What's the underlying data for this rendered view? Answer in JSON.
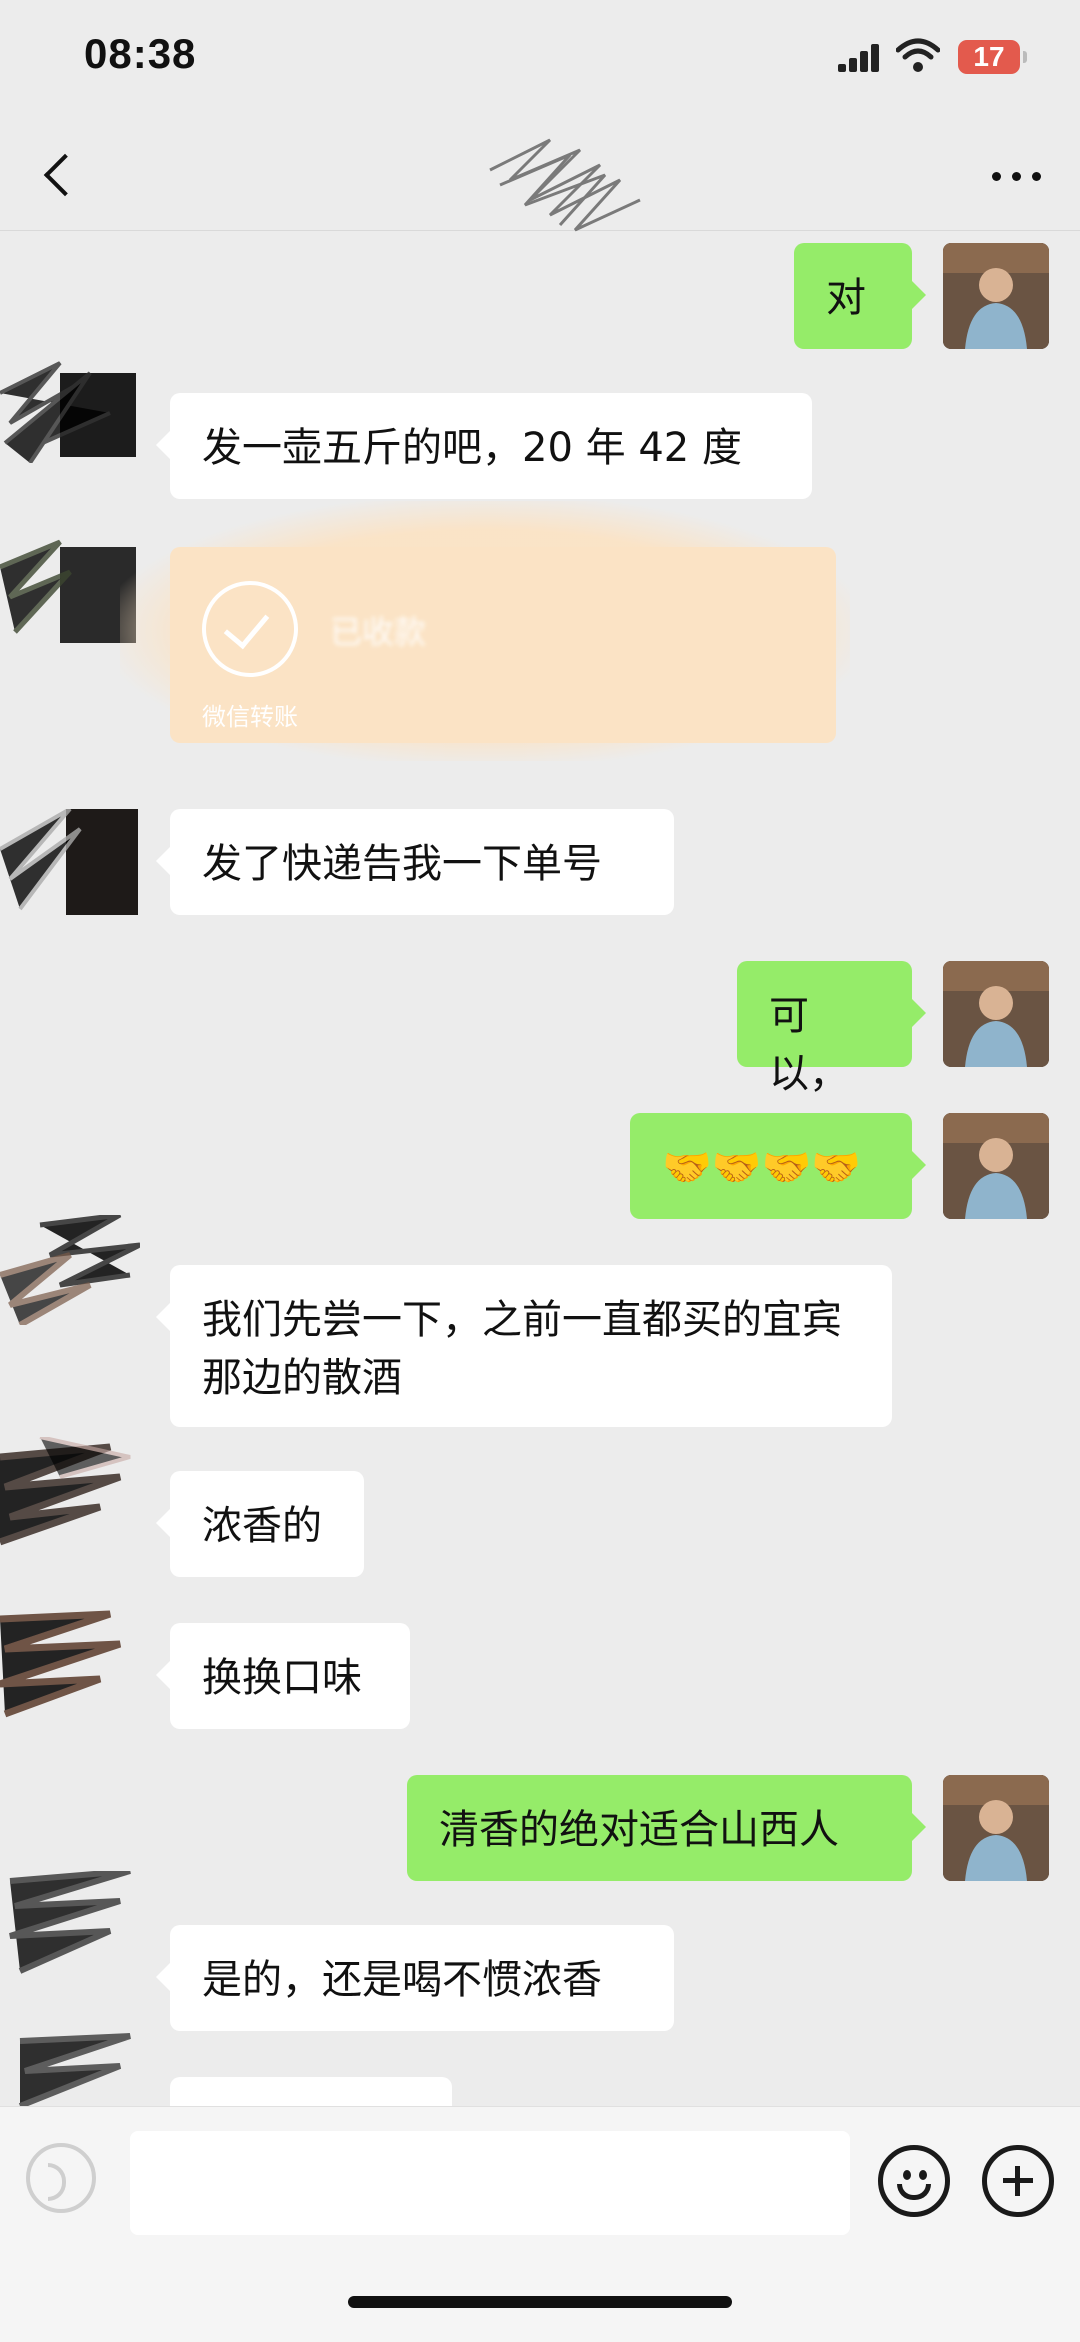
{
  "status_bar": {
    "time": "08:38",
    "battery": "17"
  },
  "nav": {
    "title": ""
  },
  "messages": [
    {
      "side": "right",
      "text": "对"
    },
    {
      "side": "left",
      "text": "发一壶五斤的吧，20 年 42 度"
    },
    {
      "side": "left",
      "type": "transfer",
      "status": "已收款",
      "label": "微信转账"
    },
    {
      "side": "left",
      "text": "发了快递告我一下单号"
    },
    {
      "side": "right",
      "text": "可以，"
    },
    {
      "side": "right",
      "text": "🤝🤝🤝🤝"
    },
    {
      "side": "left",
      "text": "我们先尝一下，之前一直都买的宜宾那边的散酒"
    },
    {
      "side": "left",
      "text": "浓香的"
    },
    {
      "side": "left",
      "text": "换换口味"
    },
    {
      "side": "right",
      "text": "清香的绝对适合山西人"
    },
    {
      "side": "left",
      "text": "是的，还是喝不惯浓香"
    }
  ],
  "input": {
    "value": "",
    "placeholder": ""
  },
  "icons": {
    "back": "chevron-left-icon",
    "more": "more-dots-icon",
    "voice": "voice-icon",
    "emoji": "emoji-icon",
    "plus": "plus-icon"
  },
  "colors": {
    "background": "#ececec",
    "bubble_me": "#95ec69",
    "bubble_other": "#ffffff",
    "transfer": "#fbe3c5",
    "battery": "#e35a4d"
  }
}
